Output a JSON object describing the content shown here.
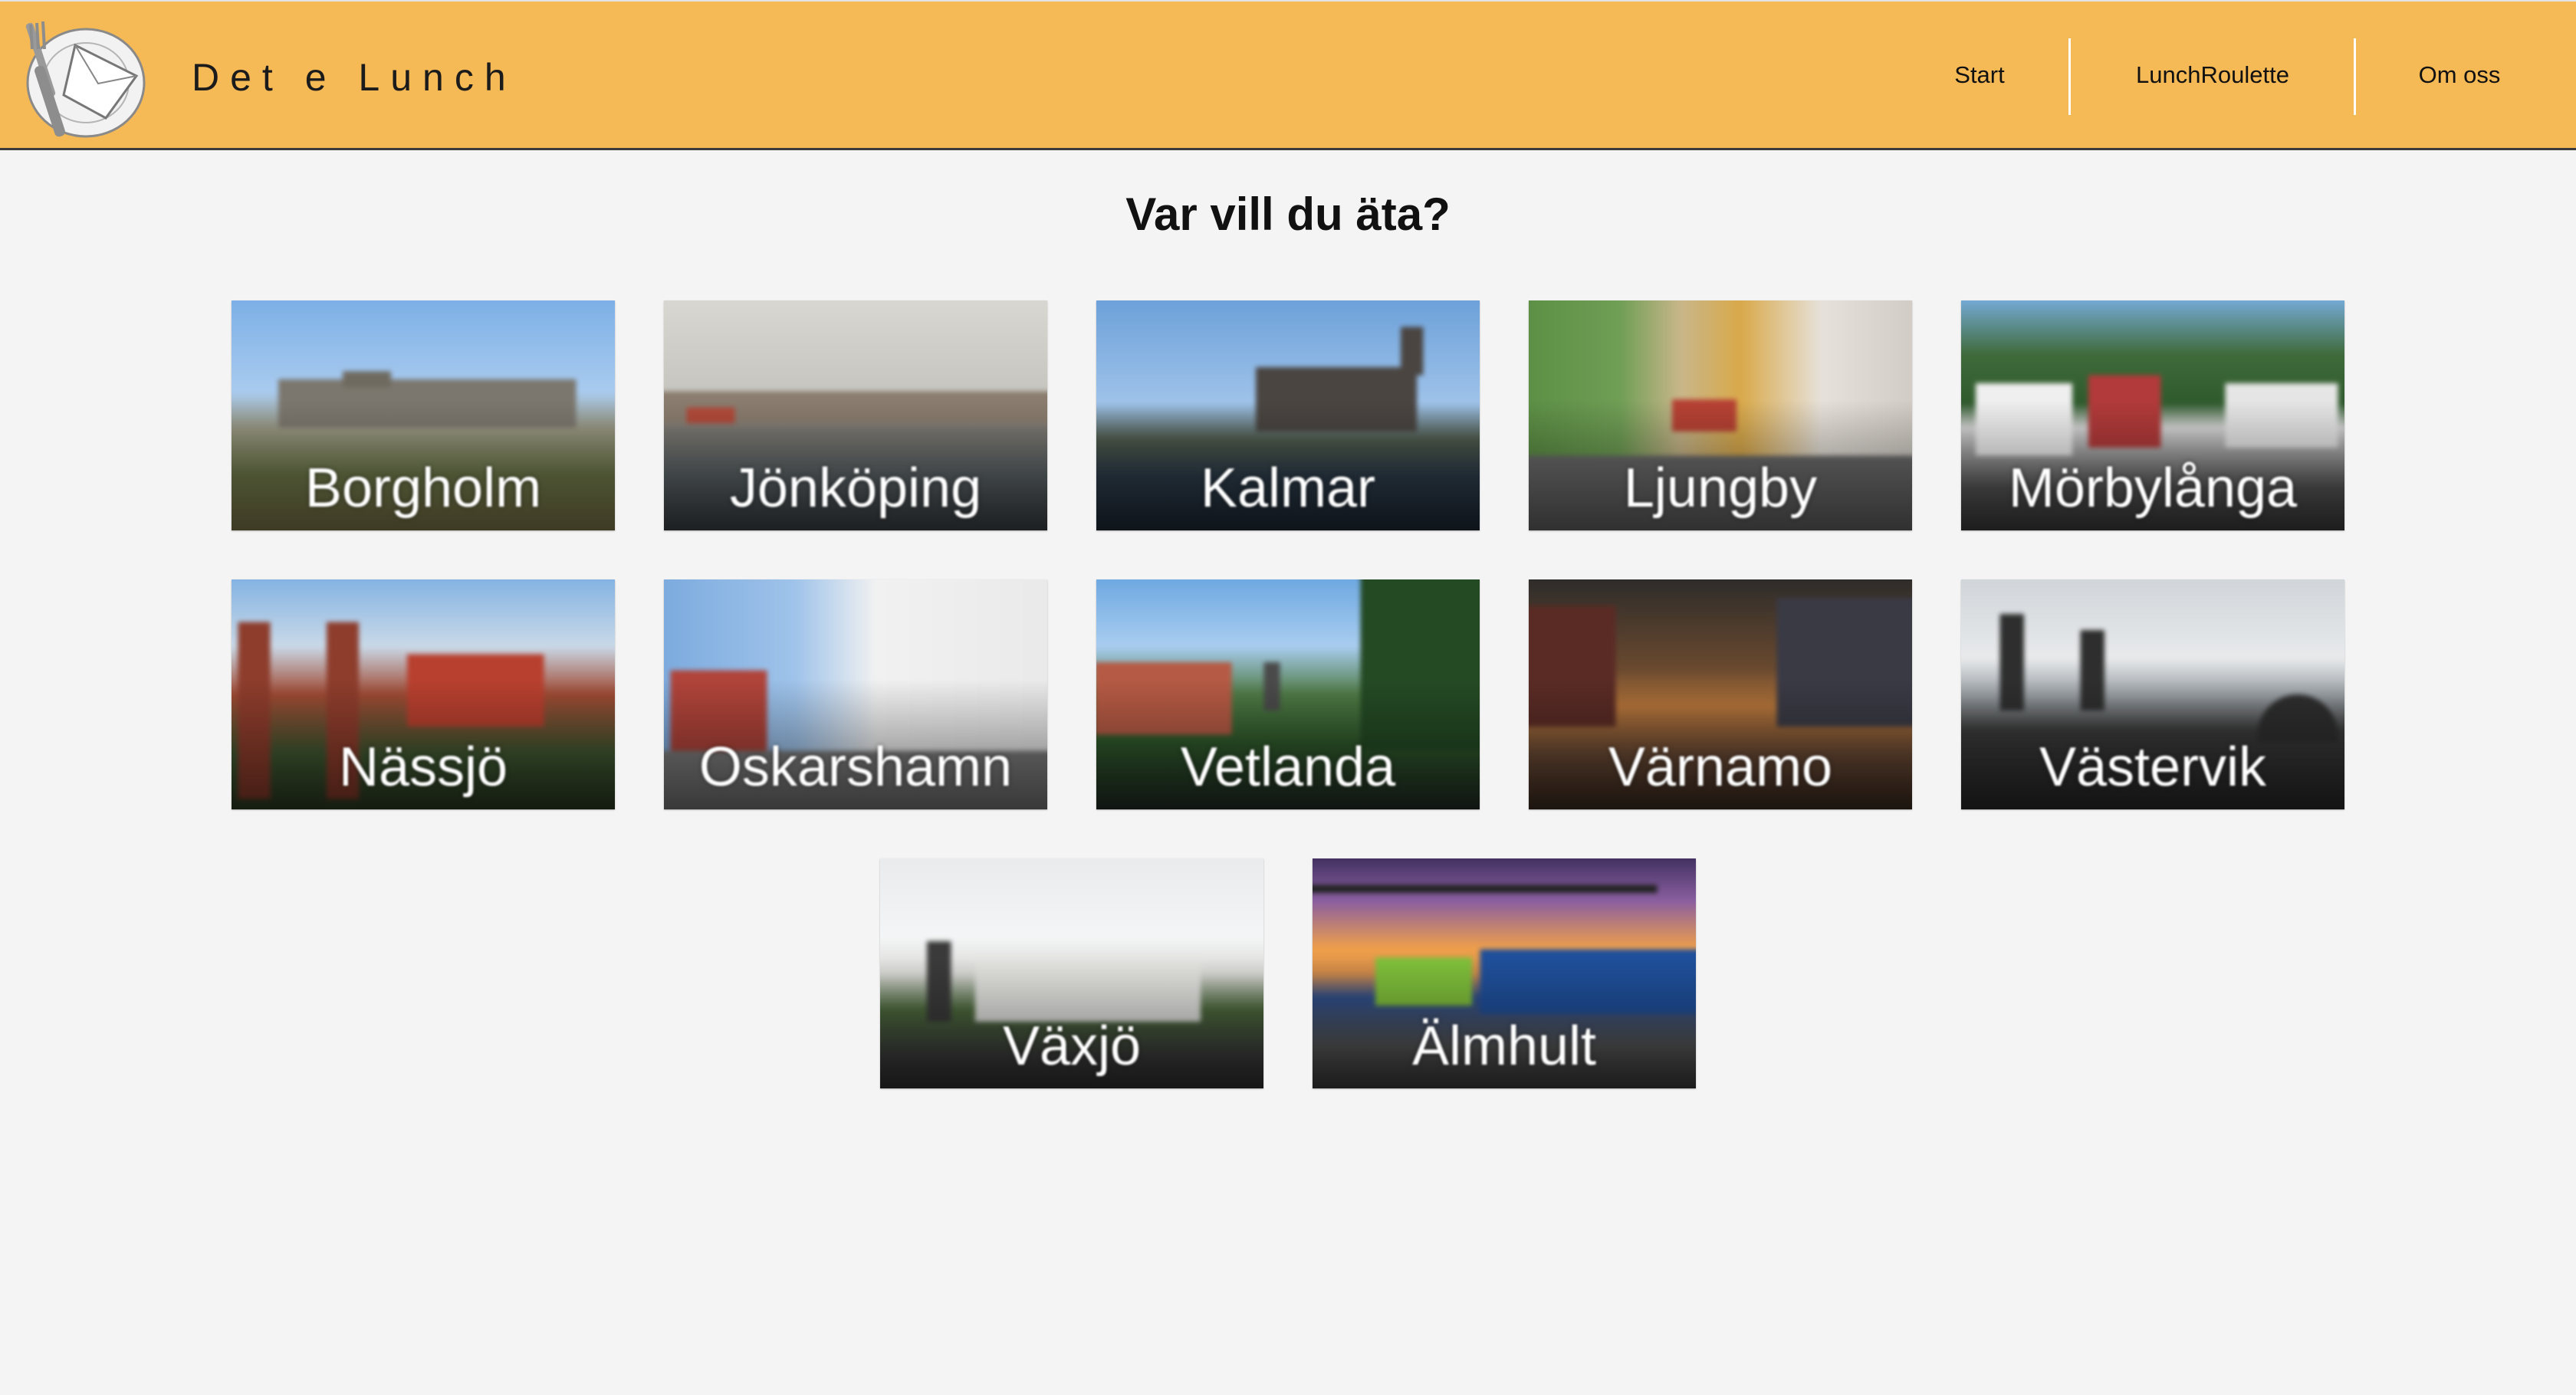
{
  "header": {
    "brand": "Det e Lunch",
    "logo_icon": "plate-fork-knife-icon",
    "nav": [
      {
        "label": "Start"
      },
      {
        "label": "LunchRoulette"
      },
      {
        "label": "Om oss"
      }
    ],
    "background_color": "#f5b955"
  },
  "main": {
    "heading": "Var vill du äta?",
    "cities": [
      {
        "name": "Borgholm"
      },
      {
        "name": "Jönköping"
      },
      {
        "name": "Kalmar"
      },
      {
        "name": "Ljungby"
      },
      {
        "name": "Mörbylånga"
      },
      {
        "name": "Nässjö"
      },
      {
        "name": "Oskarshamn"
      },
      {
        "name": "Vetlanda"
      },
      {
        "name": "Värnamo"
      },
      {
        "name": "Västervik"
      },
      {
        "name": "Växjö"
      },
      {
        "name": "Älmhult"
      }
    ]
  }
}
